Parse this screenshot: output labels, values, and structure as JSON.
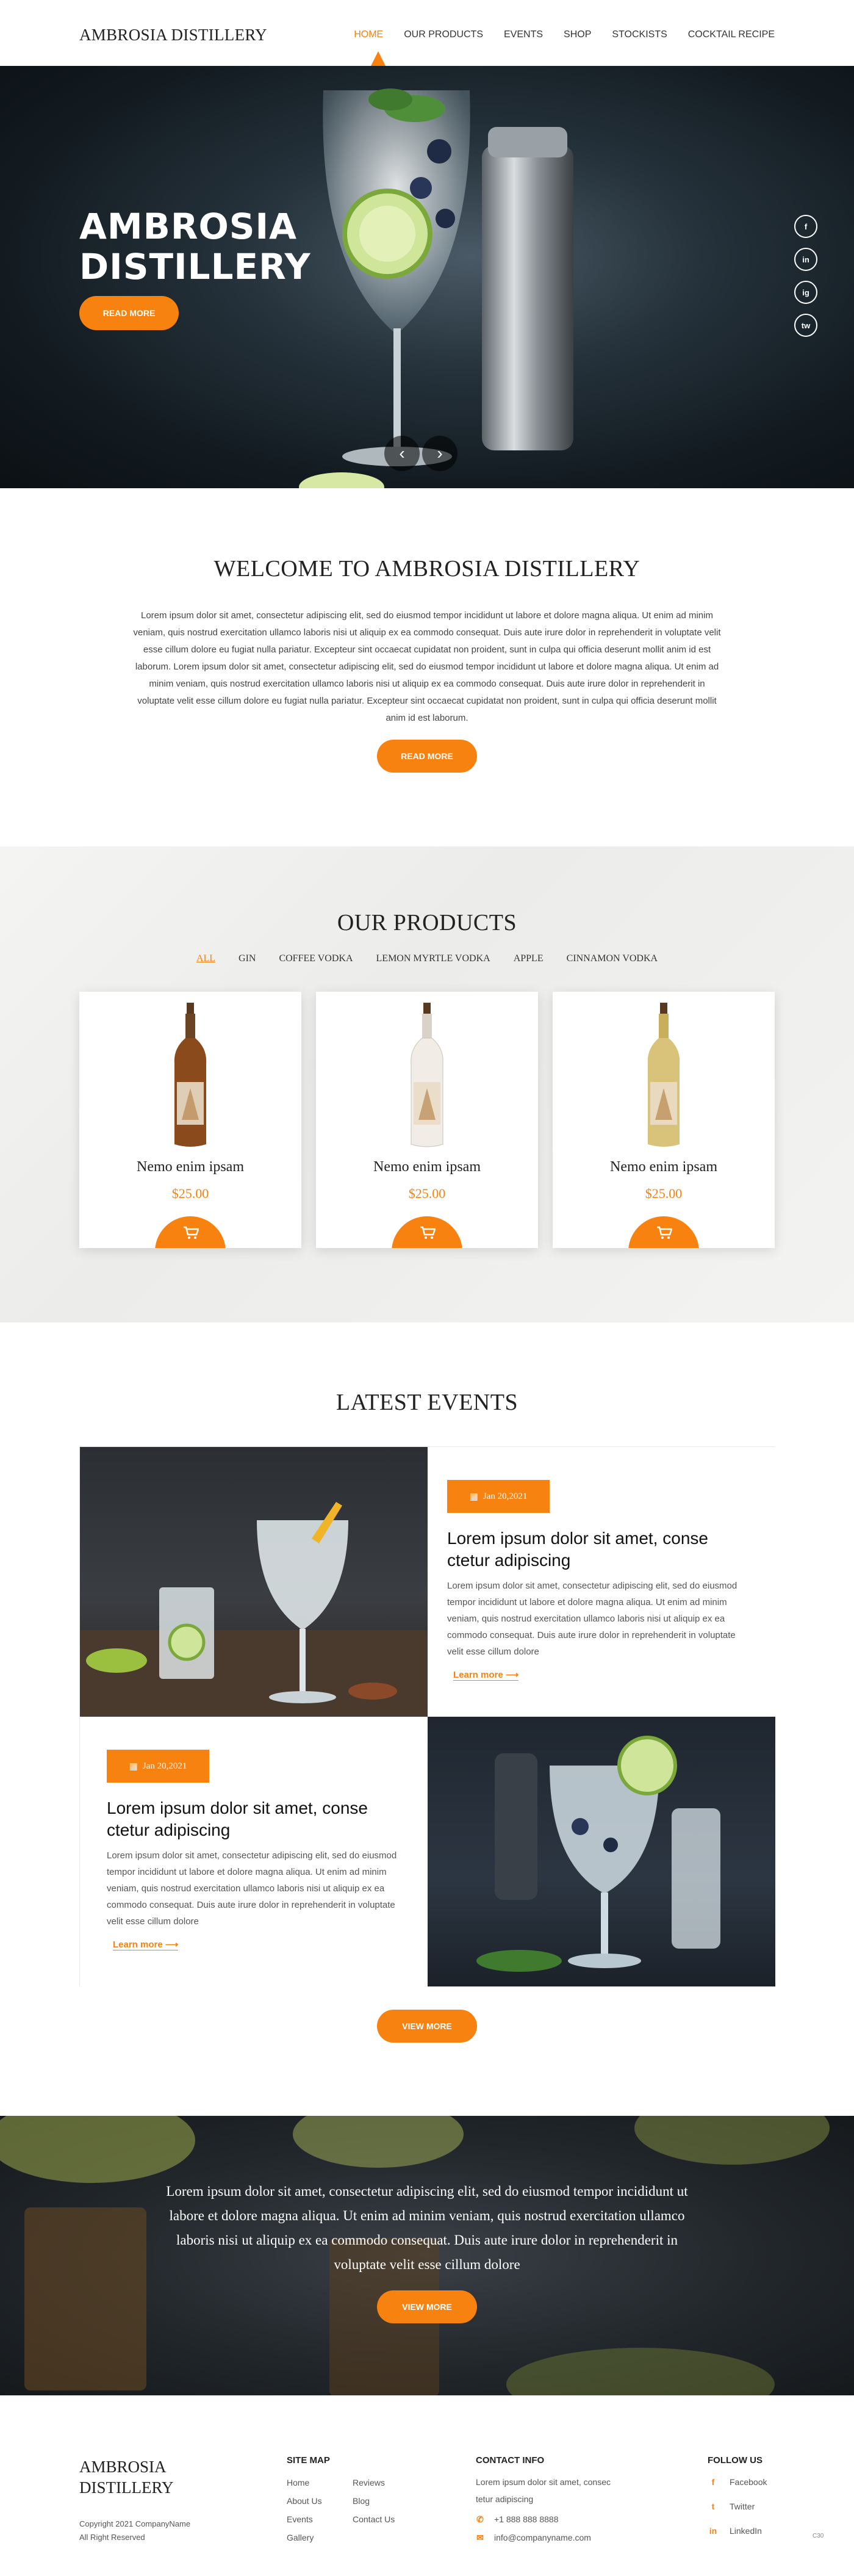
{
  "header": {
    "logo": "AMBROSIA DISTILLERY",
    "nav": [
      "HOME",
      "OUR PRODUCTS",
      "EVENTS",
      "SHOP",
      "STOCKISTS",
      "COCKTAIL RECIPE"
    ],
    "active_index": 0
  },
  "hero": {
    "title_line1": "AMBROSIA",
    "title_line2": "DISTILLERY",
    "button": "READ MORE",
    "social": [
      "f",
      "in",
      "ig",
      "tw"
    ]
  },
  "welcome": {
    "title": "WELCOME TO AMBROSIA DISTILLERY",
    "text": "Lorem ipsum dolor sit amet, consectetur adipiscing elit, sed do eiusmod tempor incididunt ut labore et dolore magna aliqua. Ut enim ad minim veniam, quis nostrud exercitation ullamco laboris nisi ut aliquip ex ea commodo consequat. Duis aute irure dolor in reprehenderit in voluptate velit esse cillum dolore eu fugiat nulla pariatur. Excepteur sint occaecat cupidatat non proident, sunt in culpa qui officia deserunt mollit anim id est laborum. Lorem ipsum dolor sit amet, consectetur adipiscing elit, sed do eiusmod tempor incididunt ut labore et dolore magna aliqua. Ut enim ad minim veniam, quis nostrud exercitation ullamco laboris nisi ut aliquip ex ea commodo consequat. Duis aute irure dolor in reprehenderit in voluptate velit esse cillum dolore eu fugiat nulla pariatur. Excepteur sint occaecat cupidatat non proident, sunt in culpa qui officia deserunt mollit anim id est laborum.",
    "button": "READ MORE"
  },
  "products": {
    "title": "OUR PRODUCTS",
    "filters": [
      "ALL",
      "GIN",
      "COFFEE VODKA",
      "LEMON MYRTLE VODKA",
      "APPLE",
      "CINNAMON VODKA"
    ],
    "active_filter": 0,
    "items": [
      {
        "name": "Nemo enim ipsam",
        "price": "$25.00",
        "liquid": "#8a4a1c"
      },
      {
        "name": "Nemo enim ipsam",
        "price": "$25.00",
        "liquid": "#f1ede6"
      },
      {
        "name": "Nemo enim ipsam",
        "price": "$25.00",
        "liquid": "#d9c27a"
      }
    ]
  },
  "events": {
    "title": "LATEST EVENTS",
    "items": [
      {
        "date": "Jan 20,2021",
        "title": "Lorem ipsum dolor sit amet, conse ctetur adipiscing",
        "text": "Lorem ipsum dolor sit amet, consectetur adipiscing elit, sed do eiusmod tempor incididunt ut labore et dolore magna aliqua. Ut enim ad minim veniam, quis nostrud exercitation ullamco laboris nisi ut aliquip ex ea commodo consequat. Duis aute irure dolor in reprehenderit in voluptate velit esse cillum dolore",
        "link": "Learn more ⟶"
      },
      {
        "date": "Jan 20,2021",
        "title": "Lorem ipsum dolor sit amet, conse ctetur adipiscing",
        "text": "Lorem ipsum dolor sit amet, consectetur adipiscing elit, sed do eiusmod tempor incididunt ut labore et dolore magna aliqua. Ut enim ad minim veniam, quis nostrud exercitation ullamco laboris nisi ut aliquip ex ea commodo consequat. Duis aute irure dolor in reprehenderit in voluptate velit esse cillum dolore",
        "link": "Learn more ⟶"
      }
    ],
    "button": "VIEW MORE"
  },
  "banner": {
    "text": "Lorem ipsum dolor sit amet, consectetur adipiscing elit, sed do eiusmod tempor incididunt ut labore et dolore magna aliqua. Ut enim ad minim veniam, quis nostrud exercitation ullamco laboris nisi ut aliquip ex ea commodo consequat. Duis aute irure dolor in reprehenderit in voluptate velit esse cillum dolore",
    "button": "VIEW MORE"
  },
  "footer": {
    "logo_line1": "AMBROSIA",
    "logo_line2": "DISTILLERY",
    "copyright_line1": "Copyright 2021 CompanyName",
    "copyright_line2": "All Right Reserved",
    "sitemap_title": "SITE MAP",
    "sitemap_col1": [
      "Home",
      "About Us",
      "Events",
      "Gallery"
    ],
    "sitemap_col2": [
      "Reviews",
      "Blog",
      "Contact Us"
    ],
    "contact_title": "CONTACT INFO",
    "contact_address": "Lorem ipsum dolor sit amet, consec tetur adipiscing",
    "contact_phone": "+1 888 888 8888",
    "contact_email": "info@companyname.com",
    "follow_title": "FOLLOW US",
    "follow": [
      "Facebook",
      "Twitter",
      "LinkedIn"
    ],
    "mark": "C30"
  },
  "colors": {
    "accent": "#f7820f"
  }
}
